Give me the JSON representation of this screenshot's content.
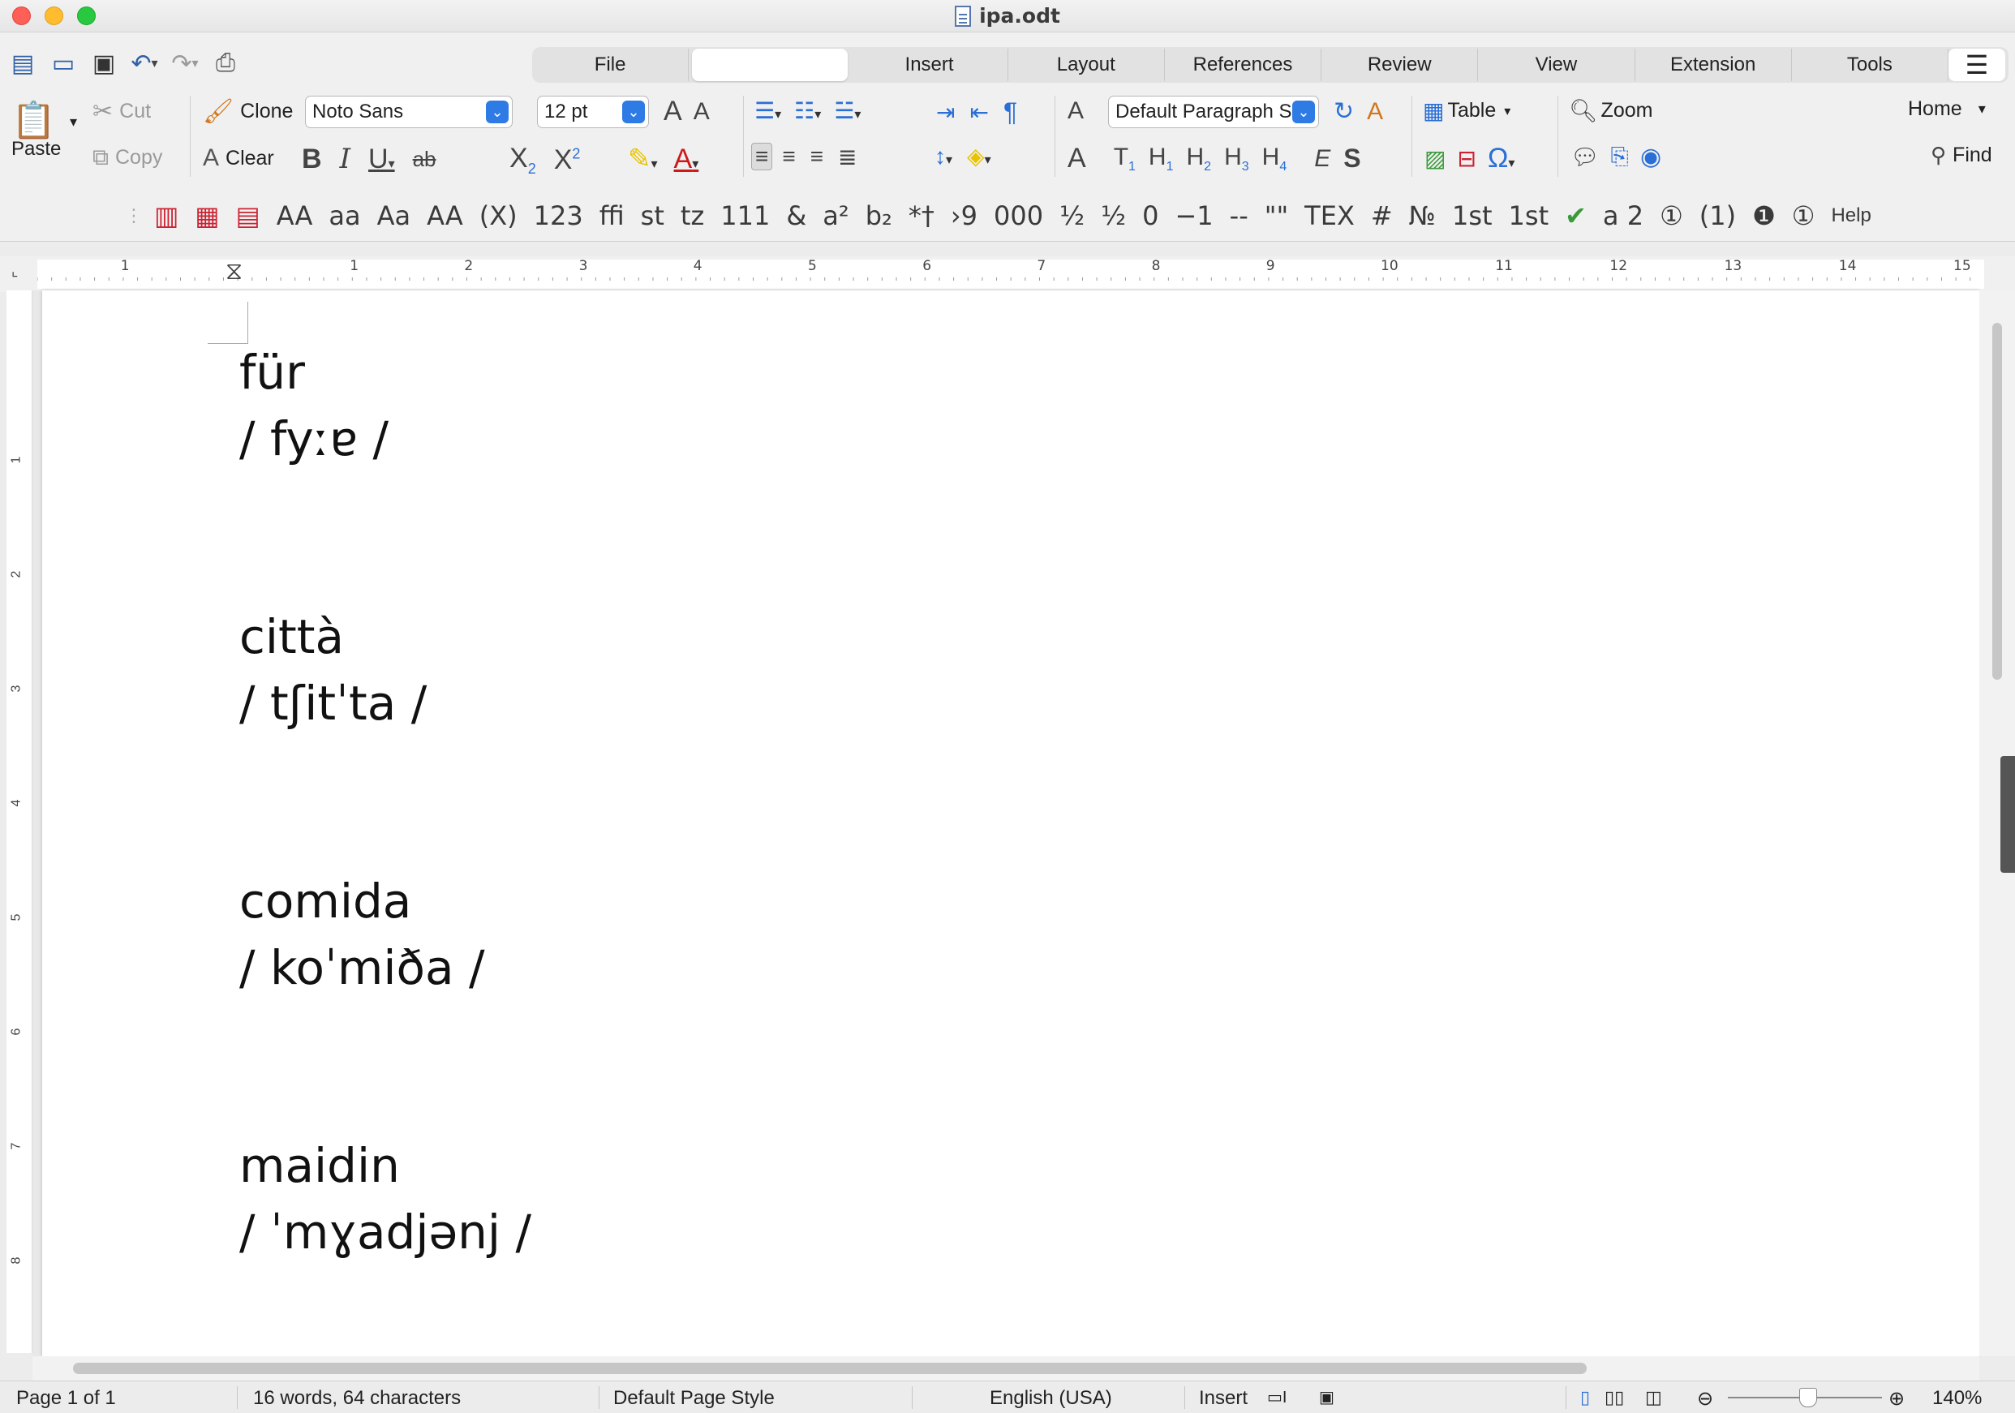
{
  "window": {
    "title": "ipa.odt"
  },
  "tabs": [
    {
      "label": "File"
    },
    {
      "label": ""
    },
    {
      "label": "Insert"
    },
    {
      "label": "Layout"
    },
    {
      "label": "References"
    },
    {
      "label": "Review"
    },
    {
      "label": "View"
    },
    {
      "label": "Extension"
    },
    {
      "label": "Tools"
    }
  ],
  "toolbar": {
    "paste": "Paste",
    "cut": "Cut",
    "copy": "Copy",
    "clone": "Clone",
    "clear": "Clear",
    "font_name": "Noto Sans",
    "font_size": "12 pt",
    "paragraph_style": "Default Paragraph S",
    "table": "Table",
    "zoom": "Zoom",
    "home": "Home",
    "find": "Find",
    "help": "Help"
  },
  "typography_toolbar": [
    "AA",
    "aa",
    "Aa",
    "AA",
    "(X)",
    "123",
    "ffi",
    "st",
    "tz",
    "111",
    "&",
    "a²",
    "b₂",
    "*†",
    "›9",
    "000",
    "½",
    "½",
    "0",
    "−1",
    "--",
    "\"\"",
    "TEX",
    "#",
    "№",
    "1st",
    "1st",
    "a 2",
    "①",
    "(1)",
    "❶",
    "①"
  ],
  "ruler_numbers": [
    "1",
    "1",
    "2",
    "3",
    "4",
    "5",
    "6",
    "7",
    "8",
    "9",
    "10",
    "11",
    "12",
    "13",
    "14",
    "15"
  ],
  "vruler_numbers": [
    "1",
    "2",
    "3",
    "4",
    "5",
    "6",
    "7",
    "8"
  ],
  "document": {
    "entries": [
      {
        "word": "für",
        "ipa": "/ fyːɐ /"
      },
      {
        "word": "città",
        "ipa": "/ tʃitˈta /"
      },
      {
        "word": "comida",
        "ipa": "/ koˈmiða /"
      },
      {
        "word": "maidin",
        "ipa": "/ ˈmɣadjənj /"
      }
    ]
  },
  "status": {
    "page": "Page 1 of 1",
    "words": "16 words, 64 characters",
    "page_style": "Default Page Style",
    "language": "English (USA)",
    "mode": "Insert",
    "zoom": "140%",
    "zoom_level": 140
  }
}
